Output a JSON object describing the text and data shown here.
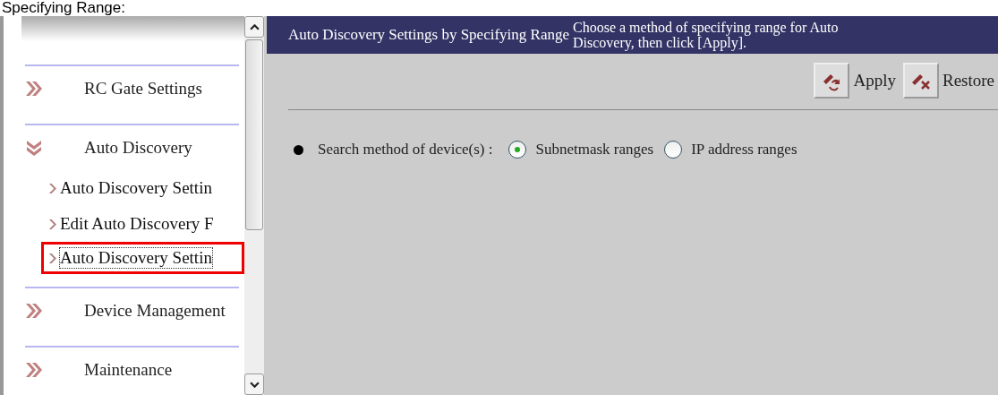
{
  "caption": "Specifying Range:",
  "sidebar": {
    "items": [
      {
        "label": "RC Gate Settings",
        "expanded": false
      },
      {
        "label": "Auto Discovery",
        "expanded": true,
        "children": [
          {
            "label": "Auto Discovery Settin",
            "selected": false
          },
          {
            "label": "Edit Auto Discovery F",
            "selected": false
          },
          {
            "label": "Auto Discovery Settin",
            "selected": true
          }
        ]
      },
      {
        "label": "Device Management",
        "expanded": false
      },
      {
        "label": "Maintenance",
        "expanded": false
      }
    ]
  },
  "header": {
    "title": "Auto Discovery Settings by Specifying Range",
    "instruction": "Choose a method of specifying range for Auto Discovery, then click [Apply]."
  },
  "toolbar": {
    "buttons": [
      {
        "label": "Apply",
        "kind": "apply"
      },
      {
        "label": "Restore",
        "kind": "restore"
      }
    ]
  },
  "search_method": {
    "label": "Search method of device(s) :",
    "options": [
      {
        "label": "Subnetmask ranges",
        "selected": true
      },
      {
        "label": "IP address ranges",
        "selected": false
      }
    ]
  }
}
